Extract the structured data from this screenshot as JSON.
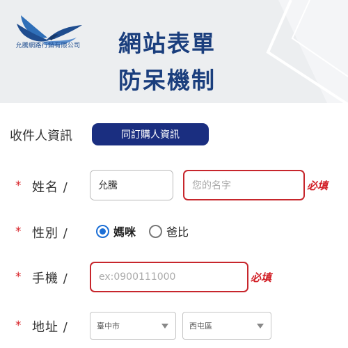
{
  "banner": {
    "company_name": "允騰網路行銷有限公司",
    "title_line1": "網站表單",
    "title_line2": "防呆機制"
  },
  "form": {
    "section_title": "收件人資訊",
    "copy_button": "同訂購人資訊",
    "required_mark": "*",
    "required_text": "必填",
    "name": {
      "label": "姓名 /",
      "last_name_value": "允騰",
      "first_name_placeholder": "您的名字"
    },
    "gender": {
      "label": "性別 /",
      "options": [
        "媽咪",
        "爸比"
      ],
      "selected": "媽咪"
    },
    "phone": {
      "label": "手機 /",
      "placeholder": "ex:0900111000"
    },
    "address": {
      "label": "地址 /",
      "city_value": "臺中市",
      "district_value": "西屯區"
    }
  },
  "colors": {
    "brand_navy": "#1a3e7d",
    "button_navy": "#1a2e80",
    "required_red": "#d21f26",
    "radio_blue": "#1c6fd6"
  }
}
